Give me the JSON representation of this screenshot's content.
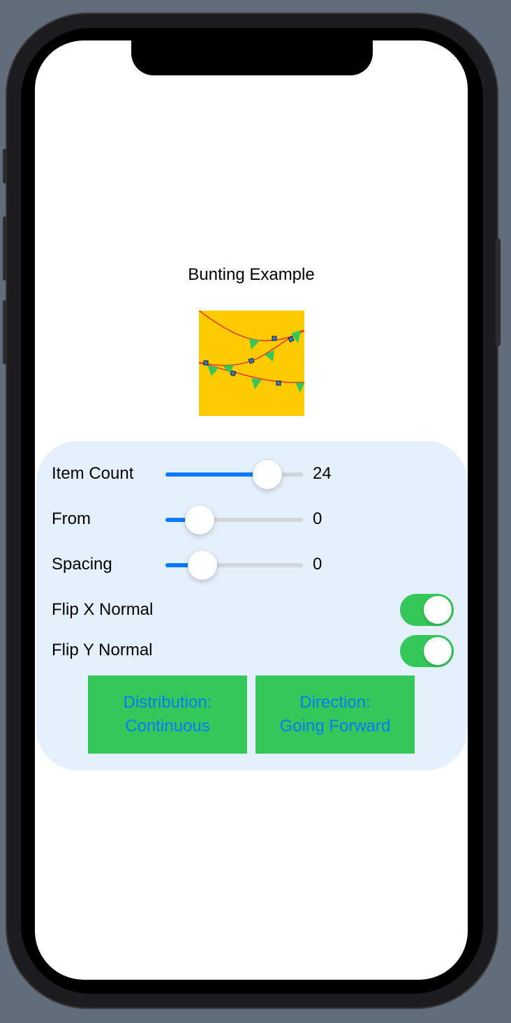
{
  "screen": {
    "title": "Bunting Example"
  },
  "preview": {
    "background_color": "#fecb00",
    "string_color": "#e83323",
    "flag_color": "#34c759",
    "marker_color": "#2f7bd6"
  },
  "controls": {
    "item_count": {
      "label": "Item Count",
      "value": "24",
      "fill_fraction": 0.74
    },
    "from": {
      "label": "From",
      "value": "0",
      "fill_fraction": 0.25
    },
    "spacing": {
      "label": "Spacing",
      "value": "0",
      "fill_fraction": 0.27
    },
    "flip_x": {
      "label": "Flip X Normal",
      "on": true
    },
    "flip_y": {
      "label": "Flip Y Normal",
      "on": true
    }
  },
  "buttons": {
    "distribution": {
      "line1": "Distribution:",
      "line2": "Continuous"
    },
    "direction": {
      "line1": "Direction:",
      "line2": "Going Forward"
    }
  },
  "colors": {
    "accent": "#0a79ff",
    "toggle_on": "#34c759",
    "panel_bg": "#e5f0fd"
  }
}
